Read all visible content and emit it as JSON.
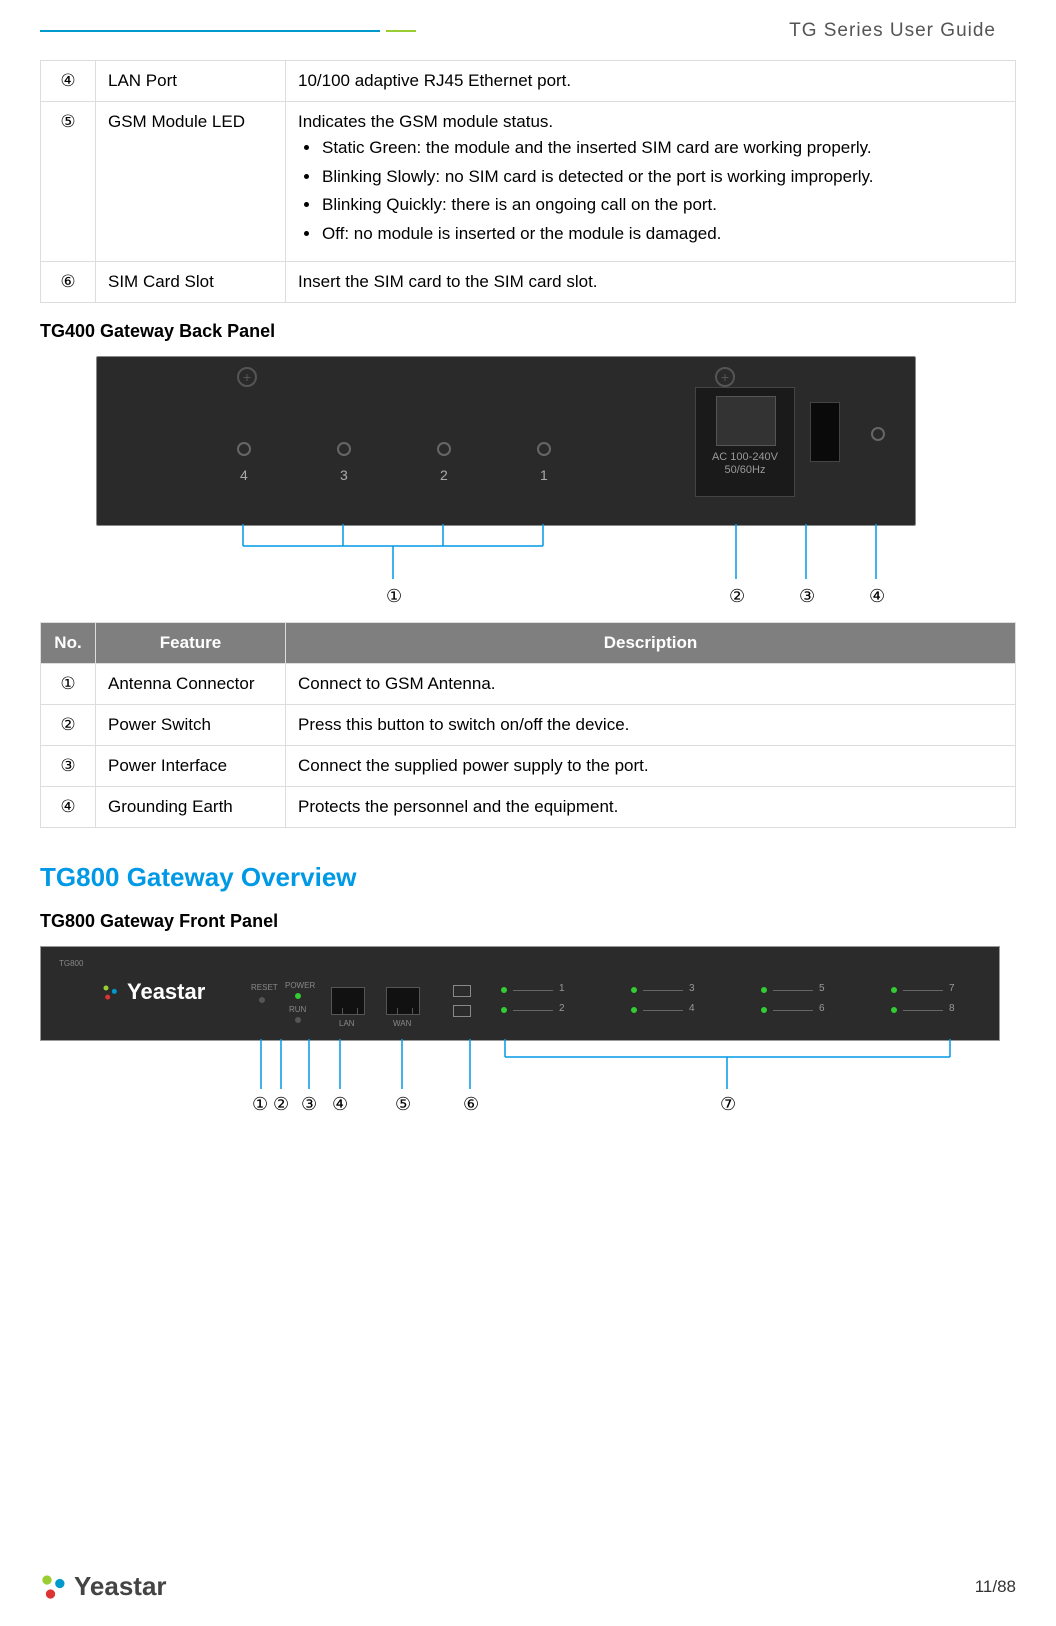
{
  "header": {
    "title": "TG  Series  User  Guide"
  },
  "table1": {
    "rows": [
      {
        "no": "④",
        "feature": "LAN Port",
        "desc": "10/100 adaptive RJ45 Ethernet port."
      },
      {
        "no": "⑤",
        "feature": "GSM Module LED",
        "desc_intro": "Indicates the GSM module status.",
        "bullets": [
          "Static Green: the module and the inserted SIM card are working properly.",
          "Blinking Slowly: no SIM card is detected or the port is working improperly.",
          "Blinking Quickly: there is an ongoing call on the port.",
          "Off: no module is inserted or the module is damaged."
        ]
      },
      {
        "no": "⑥",
        "feature": "SIM Card Slot",
        "desc": "Insert the SIM card to the SIM card slot."
      }
    ]
  },
  "section_tg400_back": "TG400 Gateway Back Panel",
  "panel400": {
    "antennas": [
      "4",
      "3",
      "2",
      "1"
    ],
    "psu_text1": "AC 100-240V",
    "psu_text2": "50/60Hz",
    "callouts": [
      "①",
      "②",
      "③",
      "④"
    ]
  },
  "table2": {
    "headers": {
      "no": "No.",
      "feature": "Feature",
      "desc": "Description"
    },
    "rows": [
      {
        "no": "①",
        "feature": "Antenna Connector",
        "desc": "Connect to GSM Antenna."
      },
      {
        "no": "②",
        "feature": "Power Switch",
        "desc": "Press this button to switch on/off the device."
      },
      {
        "no": "③",
        "feature": "Power Interface",
        "desc": "Connect the supplied power supply to the port."
      },
      {
        "no": "④",
        "feature": "Grounding Earth",
        "desc": "Protects the personnel and the equipment."
      }
    ]
  },
  "section_tg800_overview": "TG800 Gateway Overview",
  "section_tg800_front": "TG800 Gateway Front Panel",
  "panel800": {
    "brand": "Yeastar",
    "model": "TG800",
    "labels": {
      "reset": "RESET",
      "power": "POWER",
      "run": "RUN",
      "lan": "LAN",
      "wan": "WAN"
    },
    "led_nums_top": [
      "1",
      "3",
      "5",
      "7"
    ],
    "led_nums_bot": [
      "2",
      "4",
      "6",
      "8"
    ],
    "callouts": [
      "①",
      "②",
      "③",
      "④",
      "⑤",
      "⑥",
      "⑦"
    ]
  },
  "footer": {
    "brand": "Yeastar",
    "page": "11/88"
  }
}
